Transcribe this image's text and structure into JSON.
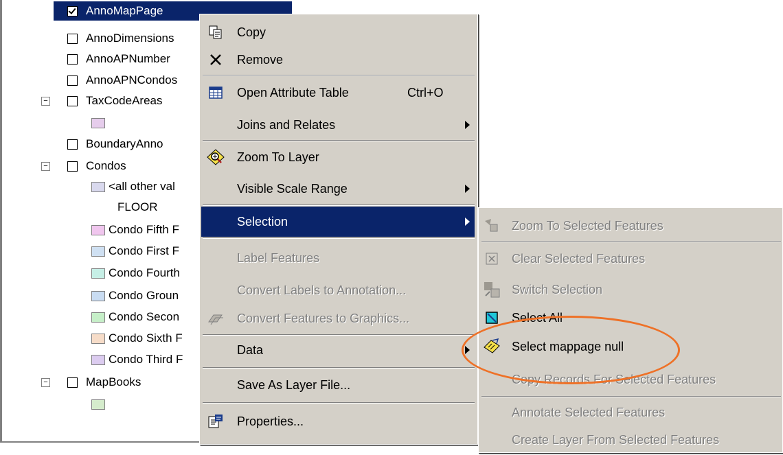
{
  "toc": {
    "items": [
      {
        "label": "AnnoMapPage",
        "checked": true,
        "selected": true
      },
      {
        "label": "AnnoDimensions",
        "checked": false
      },
      {
        "label": "AnnoAPNumber",
        "checked": false
      },
      {
        "label": "AnnoAPNCondos",
        "checked": false
      },
      {
        "label": "TaxCodeAreas",
        "checked": false,
        "expander": "⊟"
      },
      {
        "label": "BoundaryAnno",
        "checked": false
      },
      {
        "label": "Condos",
        "checked": false,
        "expander": "⊟"
      },
      {
        "label": "<all other val",
        "swatch": "#d9d9ee"
      },
      {
        "label": "FLOOR"
      },
      {
        "label": "Condo Fifth F",
        "swatch": "#f0c6ee"
      },
      {
        "label": "Condo First F",
        "swatch": "#cfe0f2"
      },
      {
        "label": "Condo Fourth",
        "swatch": "#c6efe6"
      },
      {
        "label": "Condo Groun",
        "swatch": "#c9dcf2"
      },
      {
        "label": "Condo Secon",
        "swatch": "#c6efc8"
      },
      {
        "label": "Condo Sixth F",
        "swatch": "#f6dcc8"
      },
      {
        "label": "Condo Third F",
        "swatch": "#dcccf0"
      },
      {
        "label": "MapBooks",
        "checked": false,
        "expander": "⊟"
      }
    ],
    "taxcode_swatch": "#e6cdec",
    "mapbooks_swatch": "#d5eccc"
  },
  "context_menu": {
    "copy": "Copy",
    "remove": "Remove",
    "open_attr": "Open Attribute Table",
    "open_attr_shortcut": "Ctrl+O",
    "joins": "Joins and Relates",
    "zoom_layer": "Zoom To Layer",
    "visible_scale": "Visible Scale Range",
    "selection": "Selection",
    "label_features": "Label Features",
    "convert_labels": "Convert Labels to Annotation...",
    "convert_features": "Convert Features to Graphics...",
    "data": "Data",
    "save_layer": "Save As Layer File...",
    "properties": "Properties..."
  },
  "submenu": {
    "zoom_selected": "Zoom To Selected Features",
    "clear_selected": "Clear Selected Features",
    "switch_selection": "Switch Selection",
    "select_all": "Select All",
    "select_mappage": "Select mappage null",
    "copy_records": "Copy Records For Selected Features",
    "annotate_selected": "Annotate Selected Features",
    "create_layer": "Create Layer From Selected Features"
  },
  "colors": {
    "highlight": "#0a246a",
    "menu_bg": "#d4d0c8",
    "annotation_oval": "#ee7127"
  }
}
